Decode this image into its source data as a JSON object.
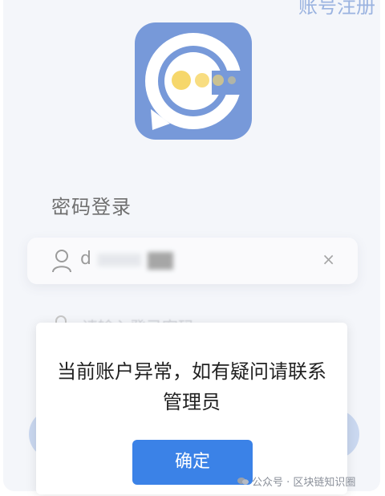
{
  "header": {
    "register_link": "账号注册"
  },
  "login": {
    "title": "密码登录"
  },
  "username": {
    "value": "d",
    "clear": "×"
  },
  "password": {
    "placeholder": "请输入登录密码"
  },
  "dialog": {
    "message_line1": "当前账户异常，如有疑问请联系",
    "message_line2": "管理员",
    "confirm": "确定"
  },
  "watermark": {
    "text": "公众号 · 区块链知识圈"
  },
  "colors": {
    "logo_bg": "#2f63c5",
    "accent": "#3b82e7",
    "coin": "#f2c21c"
  },
  "icons": [
    "app-logo-icon",
    "user-icon",
    "clear-icon",
    "lock-icon",
    "wechat-icon"
  ]
}
